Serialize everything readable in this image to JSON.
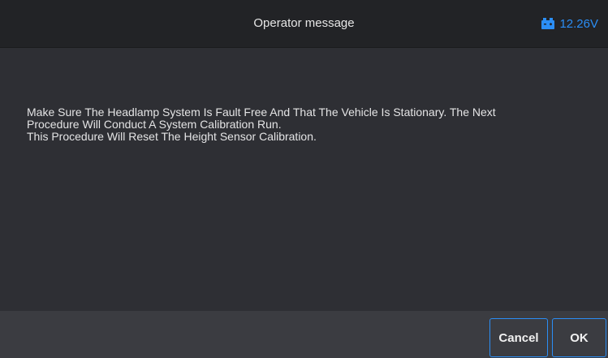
{
  "header": {
    "title": "Operator message",
    "voltage": "12.26V",
    "battery_icon": "car-battery-icon"
  },
  "message": {
    "lines": [
      "Make Sure The Headlamp System Is Fault Free And That The Vehicle Is Stationary. The Next",
      "Procedure Will Conduct A System Calibration Run.",
      "This Procedure Will Reset The Height Sensor Calibration."
    ]
  },
  "footer": {
    "cancel_label": "Cancel",
    "ok_label": "OK"
  },
  "colors": {
    "accent": "#2b8ef5",
    "header_bg": "#222326",
    "content_bg": "#2e2f34",
    "footer_bg": "#3b3c41"
  }
}
